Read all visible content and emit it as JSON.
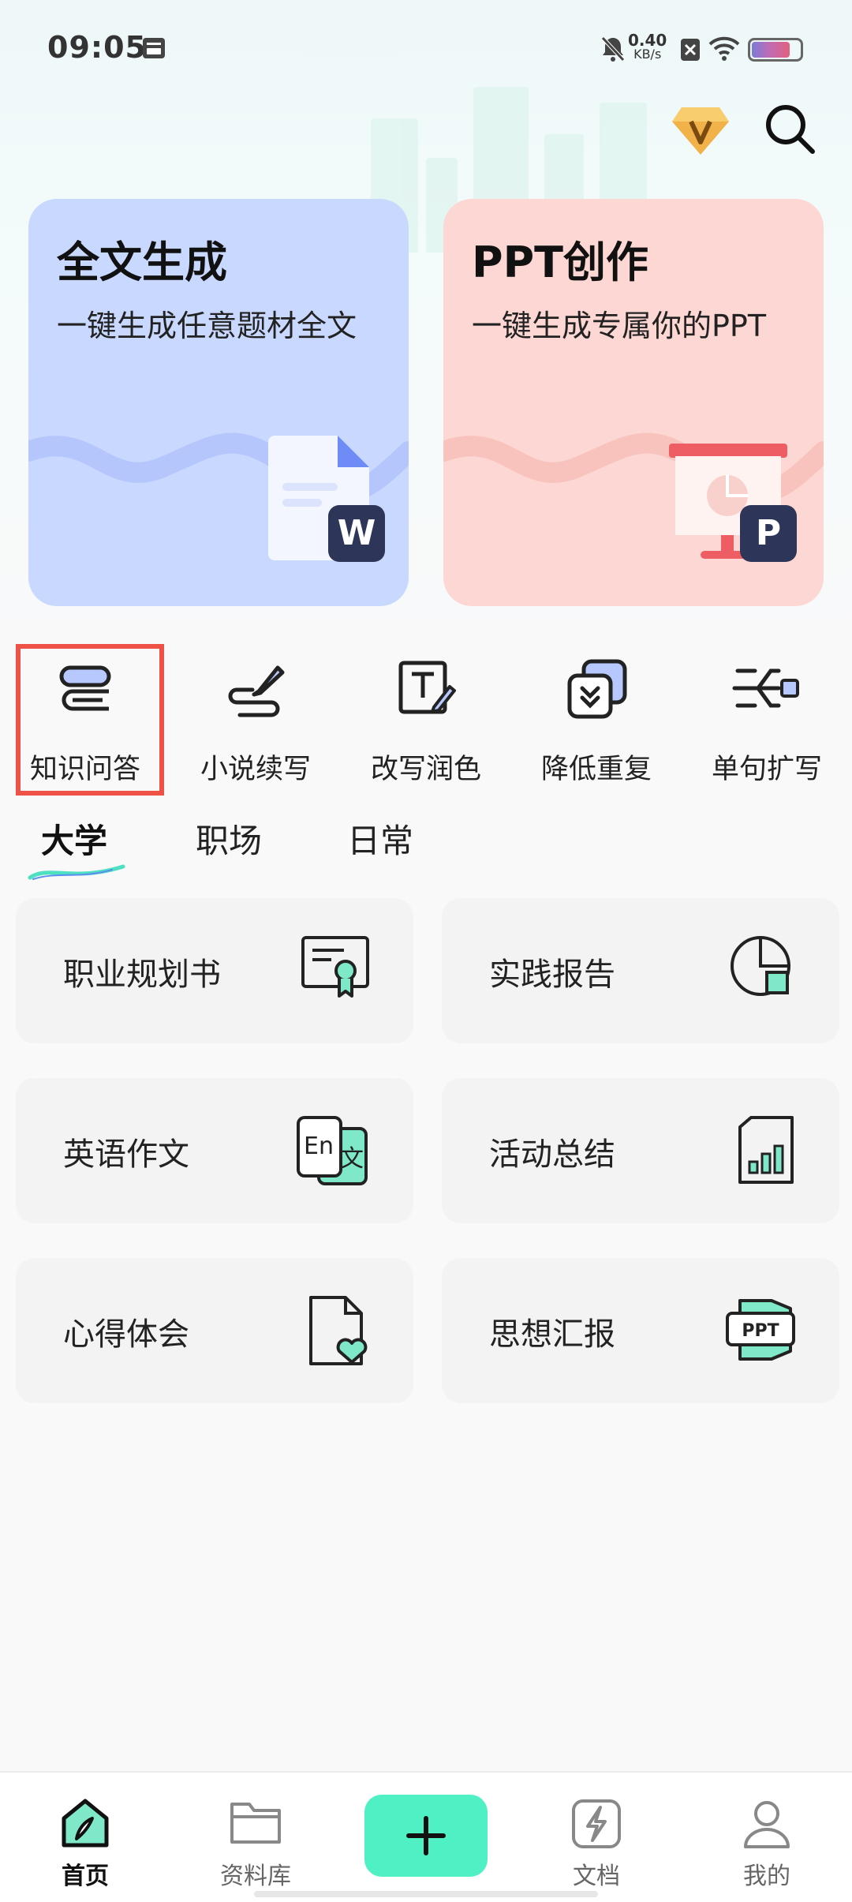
{
  "status_bar": {
    "time": "09:05",
    "net_speed_value": "0.40",
    "net_speed_unit": "KB/s",
    "battery_level": 0.82
  },
  "header": {
    "vip_icon": "diamond-v-icon",
    "search_icon": "search-icon"
  },
  "feature_cards": [
    {
      "title": "全文生成",
      "subtitle": "一键生成任意题材全文",
      "badge": "W",
      "color": "#c9d8fe"
    },
    {
      "title": "PPT创作",
      "subtitle": "一键生成专属你的PPT",
      "badge": "P",
      "color": "#fcd7d3"
    }
  ],
  "tools": [
    {
      "label": "知识问答",
      "icon": "books-icon",
      "highlighted": true
    },
    {
      "label": "小说续写",
      "icon": "pen-icon"
    },
    {
      "label": "改写润色",
      "icon": "text-edit-icon"
    },
    {
      "label": "降低重复",
      "icon": "layers-down-icon"
    },
    {
      "label": "单句扩写",
      "icon": "expand-branch-icon"
    }
  ],
  "tabs": [
    {
      "label": "大学",
      "active": true
    },
    {
      "label": "职场",
      "active": false
    },
    {
      "label": "日常",
      "active": false
    }
  ],
  "templates": [
    {
      "label": "职业规划书",
      "icon": "certificate-icon"
    },
    {
      "label": "实践报告",
      "icon": "pie-report-icon"
    },
    {
      "label": "英语作文",
      "icon": "translate-icon"
    },
    {
      "label": "活动总结",
      "icon": "chart-doc-icon"
    },
    {
      "label": "心得体会",
      "icon": "heart-doc-icon"
    },
    {
      "label": "思想汇报",
      "icon": "ppt-icon"
    }
  ],
  "template_icon_text": {
    "en": "En",
    "zh": "文",
    "ppt": "PPT"
  },
  "bottom_nav": [
    {
      "label": "首页",
      "icon": "home-pen-icon",
      "active": true
    },
    {
      "label": "资料库",
      "icon": "folder-icon",
      "active": false
    },
    {
      "label": "",
      "icon": "plus-icon",
      "active": false
    },
    {
      "label": "文档",
      "icon": "lightning-doc-icon",
      "active": false
    },
    {
      "label": "我的",
      "icon": "user-icon",
      "active": false
    }
  ],
  "colors": {
    "accent_green": "#4ff0c4",
    "highlight_red": "#ee5247",
    "icon_teal": "#7ee8c8",
    "icon_blue": "#b7c8ff"
  }
}
